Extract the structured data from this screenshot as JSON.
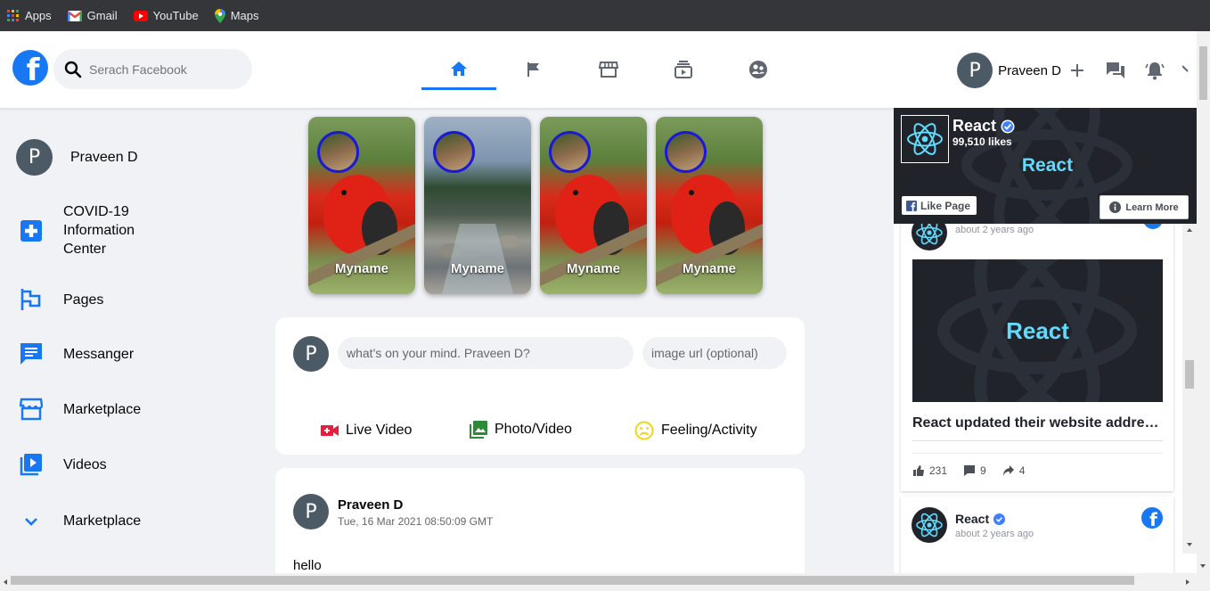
{
  "bookmarks": [
    {
      "label": "Apps",
      "icon": "apps-grid-icon"
    },
    {
      "label": "Gmail",
      "icon": "gmail-icon"
    },
    {
      "label": "YouTube",
      "icon": "youtube-icon"
    },
    {
      "label": "Maps",
      "icon": "maps-icon"
    }
  ],
  "header": {
    "logo": "f",
    "search_placeholder": "Serach Facebook",
    "user_initial": "P",
    "user_name": "Praveen D"
  },
  "sidebar": {
    "user_initial": "P",
    "user_name": "Praveen D",
    "items": [
      {
        "label": "COVID-19\nInformation\nCenter",
        "icon": "medical-cross-icon"
      },
      {
        "label": "Pages",
        "icon": "flag-icon"
      },
      {
        "label": "Messanger",
        "icon": "chat-icon"
      },
      {
        "label": "Marketplace",
        "icon": "storefront-icon"
      },
      {
        "label": "Videos",
        "icon": "video-library-icon"
      },
      {
        "label": "Marketplace",
        "icon": "chevron-down-icon"
      }
    ]
  },
  "stories": [
    {
      "name": "Myname"
    },
    {
      "name": "Myname"
    },
    {
      "name": "Myname"
    },
    {
      "name": "Myname"
    }
  ],
  "composer": {
    "user_initial": "P",
    "text_placeholder": "what's on your mind. Praveen D?",
    "image_placeholder": "image url (optional)",
    "actions": [
      {
        "label": "Live Video",
        "color": "#e41e3f"
      },
      {
        "label": "Photo/Video",
        "color": "#2d8a36"
      },
      {
        "label": "Feeling/Activity",
        "color": "#f7d217"
      }
    ]
  },
  "post": {
    "user_initial": "P",
    "author": "Praveen D",
    "timestamp": "Tue, 16 Mar 2021 08:50:09 GMT",
    "text": "hello"
  },
  "page_plugin": {
    "page_name": "React",
    "likes": "99,510 likes",
    "banner_text": "React",
    "like_button": "Like Page",
    "learn_more": "Learn More",
    "feed": [
      {
        "time": "about 2 years ago",
        "image_text": "React",
        "caption": "React updated their website addre…",
        "likes": "231",
        "comments": "9",
        "shares": "4"
      },
      {
        "name": "React",
        "time": "about 2 years ago"
      }
    ]
  },
  "colors": {
    "brand": "#1877f2",
    "react": "#61dafb",
    "avatar": "#4c5a66"
  }
}
